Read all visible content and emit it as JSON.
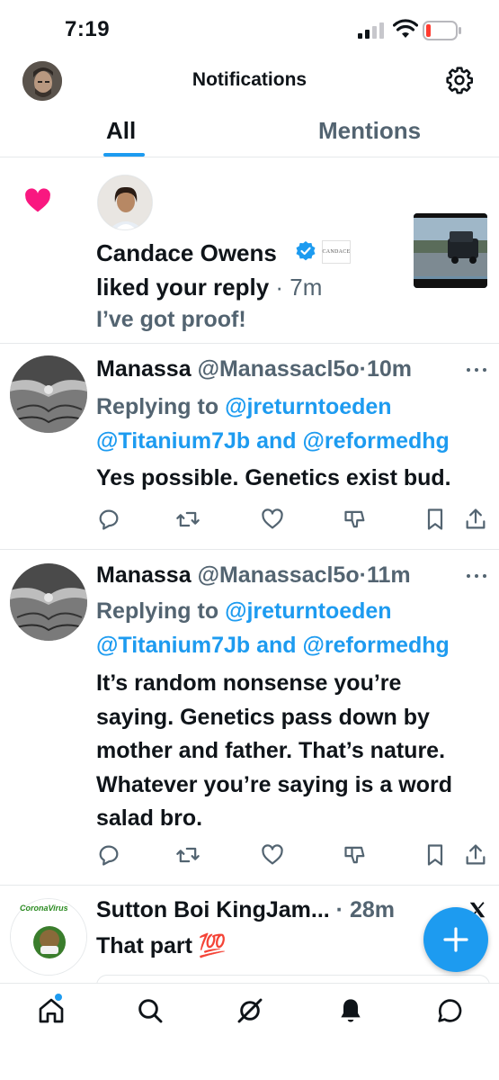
{
  "status_bar": {
    "time": "7:19"
  },
  "header": {
    "title": "Notifications"
  },
  "tabs": [
    {
      "label": "All",
      "active": true
    },
    {
      "label": "Mentions",
      "active": false
    }
  ],
  "like_notification": {
    "user_name": "Candace Owens",
    "badge_text": "CANDACE",
    "action": "liked your reply",
    "separator": " · ",
    "time": "7m",
    "preview": "I’ve got proof!"
  },
  "tweets": [
    {
      "name": "Manassa",
      "handle": "@Manassacl5o",
      "separator": "·",
      "time": "10m",
      "replying_prefix": "Replying to ",
      "mention1": "@jreturntoeden",
      "mention2": "@Titanium7Jb",
      "and_word": " and ",
      "mention3": "@reformedhg",
      "text": "Yes possible. Genetics exist bud."
    },
    {
      "name": "Manassa",
      "handle": "@Manassacl5o",
      "separator": "·",
      "time": "11m",
      "replying_prefix": "Replying to ",
      "mention1": "@jreturntoeden",
      "mention2": "@Titanium7Jb",
      "and_word": " and ",
      "mention3": "@reformedhg",
      "text": "It’s random nonsense you’re saying. Genetics pass down by mother and father. That’s nature. Whatever you’re saying is a word salad bro."
    },
    {
      "name": "Sutton Boi KingJam...",
      "separator": " · ",
      "time": "28m",
      "text": "That part 💯",
      "avatar_text": "CoronaVirus"
    }
  ],
  "icons": {
    "like": "heart-icon",
    "settings": "gear-icon",
    "verified": "verified-badge-icon",
    "reply": "reply-icon",
    "repost": "repost-icon",
    "favorite": "like-icon",
    "dislike": "dislike-icon",
    "bookmark": "bookmark-icon",
    "share": "share-icon",
    "compose": "compose-plus-icon",
    "nav": [
      "home-icon",
      "search-icon",
      "grok-icon",
      "notifications-icon",
      "messages-icon"
    ]
  },
  "colors": {
    "accent": "#1d9bf0",
    "heart": "#f91880",
    "text": "#0f1419",
    "muted": "#536471"
  }
}
